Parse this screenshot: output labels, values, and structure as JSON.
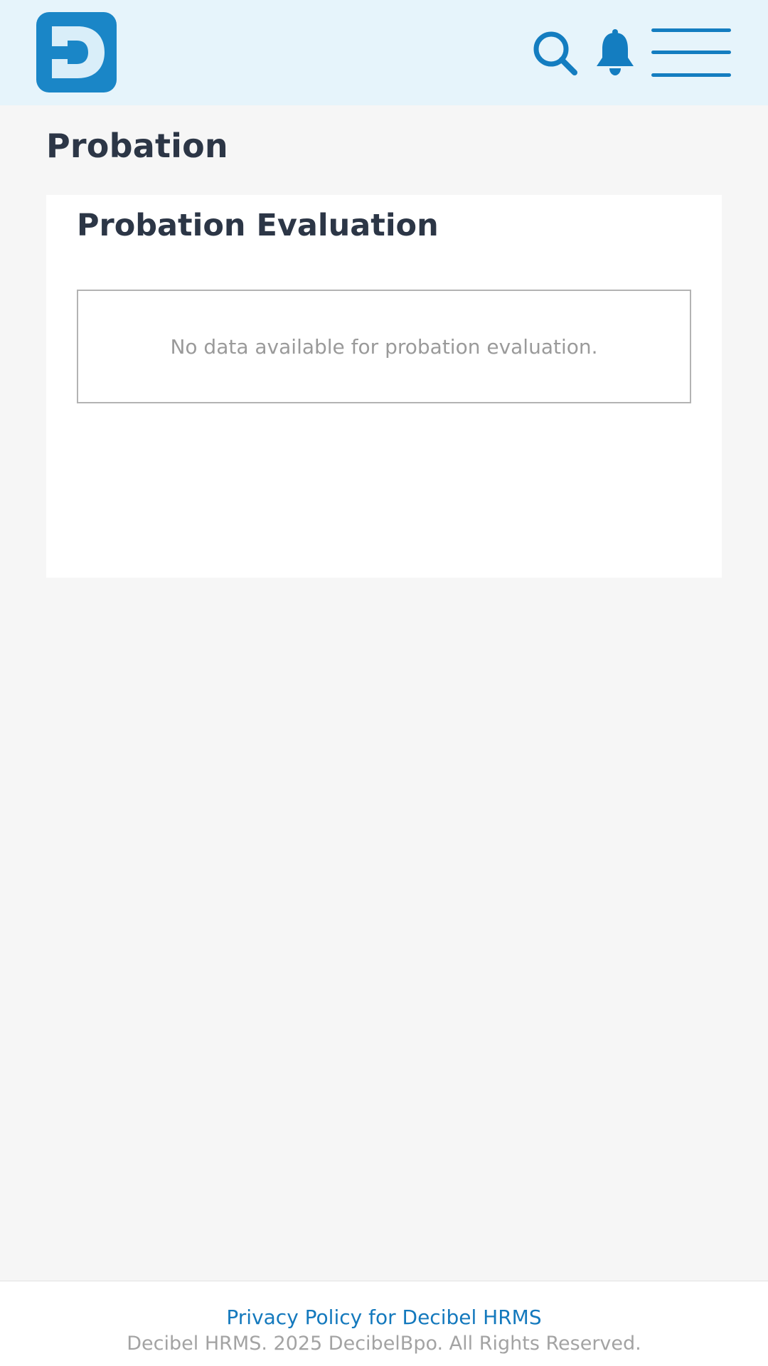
{
  "header": {
    "logo_letter": "D",
    "logo_color": "#1a86c7",
    "background": "#e6f4fb",
    "icon_color": "#147dc0",
    "icons": [
      "search-icon",
      "bell-icon",
      "hamburger-menu-icon"
    ]
  },
  "page": {
    "title": "Probation"
  },
  "card": {
    "title": "Probation Evaluation",
    "empty_message": "No data available for probation evaluation."
  },
  "footer": {
    "privacy_link": "Privacy Policy for Decibel HRMS",
    "copyright": "Decibel HRMS. 2025 DecibelBpo. All Rights Reserved.",
    "link_color": "#1479bd"
  }
}
